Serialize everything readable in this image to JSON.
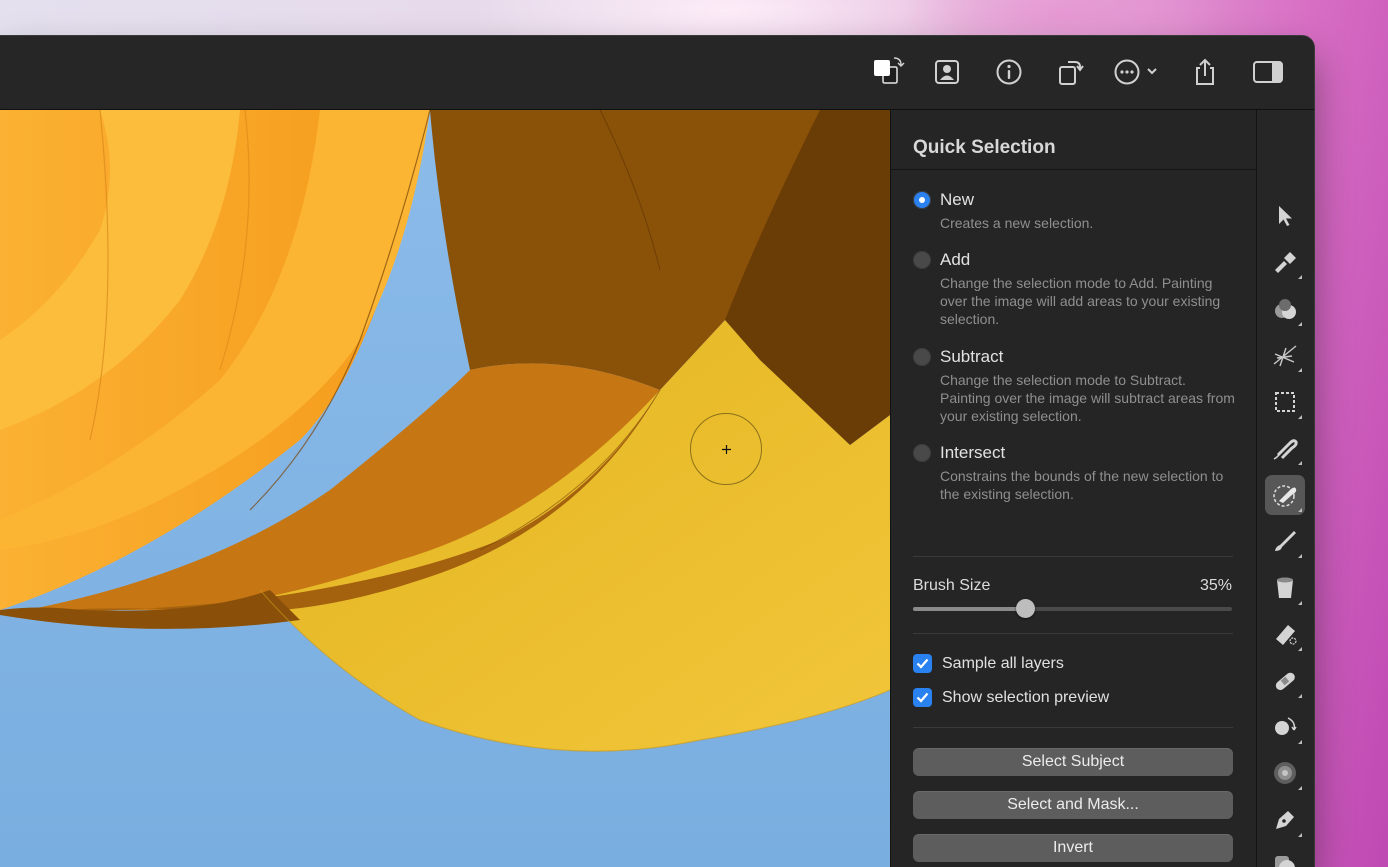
{
  "toolbar": {
    "buttons": [
      {
        "name": "swap-colors"
      },
      {
        "name": "portrait"
      },
      {
        "name": "info"
      },
      {
        "name": "rotate"
      },
      {
        "name": "more"
      },
      {
        "name": "share"
      },
      {
        "name": "sidebar"
      }
    ]
  },
  "inspector": {
    "title": "Quick Selection",
    "modes": [
      {
        "label": "New",
        "description": "Creates a new selection.",
        "selected": true
      },
      {
        "label": "Add",
        "description": "Change the selection mode to Add. Painting over the image will add areas to your existing selection.",
        "selected": false
      },
      {
        "label": "Subtract",
        "description": "Change the selection mode to Subtract. Painting over the image will subtract areas from your existing selection.",
        "selected": false
      },
      {
        "label": "Intersect",
        "description": "Constrains the bounds of the new selection to the existing selection.",
        "selected": false
      }
    ],
    "brush_size": {
      "label": "Brush Size",
      "value_text": "35%",
      "value": 0.35
    },
    "checkboxes": [
      {
        "label": "Sample all layers",
        "checked": true
      },
      {
        "label": "Show selection preview",
        "checked": true
      }
    ],
    "buttons": {
      "select_subject": "Select Subject",
      "select_and_mask": "Select and Mask...",
      "invert": "Invert"
    }
  },
  "tools": [
    {
      "name": "move-tool",
      "active": false
    },
    {
      "name": "paint-tool",
      "active": false
    },
    {
      "name": "color-adjust-tool",
      "active": false
    },
    {
      "name": "effects-tool",
      "active": false
    },
    {
      "name": "marquee-tool",
      "active": false
    },
    {
      "name": "lasso-tool",
      "active": false
    },
    {
      "name": "quick-selection-tool",
      "active": true
    },
    {
      "name": "brush-tool",
      "active": false
    },
    {
      "name": "fill-tool",
      "active": false
    },
    {
      "name": "eraser-tool",
      "active": false
    },
    {
      "name": "healing-tool",
      "active": false
    },
    {
      "name": "clone-tool",
      "active": false
    },
    {
      "name": "noise-tool",
      "active": false
    },
    {
      "name": "pen-tool",
      "active": false
    },
    {
      "name": "shape-tool",
      "active": false
    }
  ],
  "colors": {
    "accent": "#2a82f0",
    "panel": "#252525",
    "sky": "#84b4e4",
    "yellow": "#e6b82a",
    "orange": "#f4a020"
  }
}
